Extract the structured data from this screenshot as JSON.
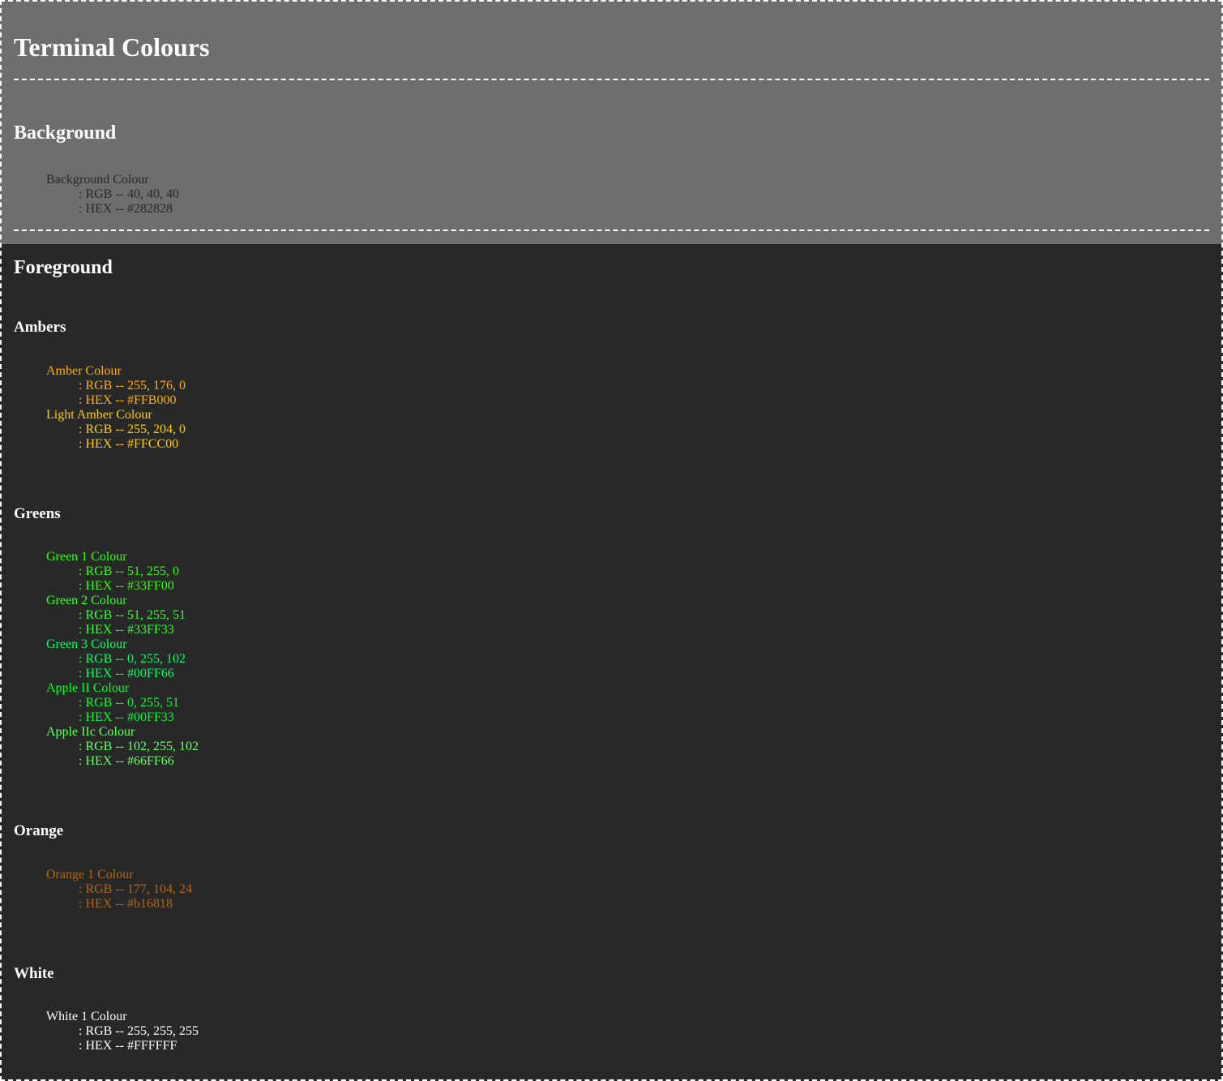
{
  "title": "Terminal Colours",
  "background": {
    "heading": "Background",
    "entries": [
      {
        "name": "Background Colour",
        "rgb": ": RGB -- 40, 40, 40",
        "hex": ": HEX -- #282828",
        "color": "#282828"
      }
    ]
  },
  "foreground": {
    "heading": "Foreground",
    "groups": [
      {
        "heading": "Ambers",
        "entries": [
          {
            "name": "Amber Colour",
            "rgb": ": RGB -- 255, 176, 0",
            "hex": ": HEX -- #FFB000",
            "color": "#FFB000"
          },
          {
            "name": "Light Amber Colour",
            "rgb": ": RGB -- 255, 204, 0",
            "hex": ": HEX -- #FFCC00",
            "color": "#FFCC00"
          }
        ]
      },
      {
        "heading": "Greens",
        "entries": [
          {
            "name": "Green 1 Colour",
            "rgb": ": RGB -- 51, 255, 0",
            "hex": ": HEX -- #33FF00",
            "color": "#33FF00"
          },
          {
            "name": "Green 2 Colour",
            "rgb": ": RGB -- 51, 255, 51",
            "hex": ": HEX -- #33FF33",
            "color": "#33FF33"
          },
          {
            "name": "Green 3 Colour",
            "rgb": ": RGB -- 0, 255, 102",
            "hex": ": HEX -- #00FF66",
            "color": "#00FF66"
          },
          {
            "name": "Apple II Colour",
            "rgb": ": RGB -- 0, 255, 51",
            "hex": ": HEX -- #00FF33",
            "color": "#00FF33"
          },
          {
            "name": "Apple IIc Colour",
            "rgb": ": RGB -- 102, 255, 102",
            "hex": ": HEX -- #66FF66",
            "color": "#66FF66"
          }
        ]
      },
      {
        "heading": "Orange",
        "entries": [
          {
            "name": "Orange 1 Colour",
            "rgb": ": RGB -- 177, 104, 24",
            "hex": ": HEX -- #b16818",
            "color": "#b16818"
          }
        ]
      },
      {
        "heading": "White",
        "entries": [
          {
            "name": "White 1 Colour",
            "rgb": ": RGB -- 255, 255, 255",
            "hex": ": HEX -- #FFFFFF",
            "color": "#FFFFFF"
          }
        ]
      }
    ]
  }
}
